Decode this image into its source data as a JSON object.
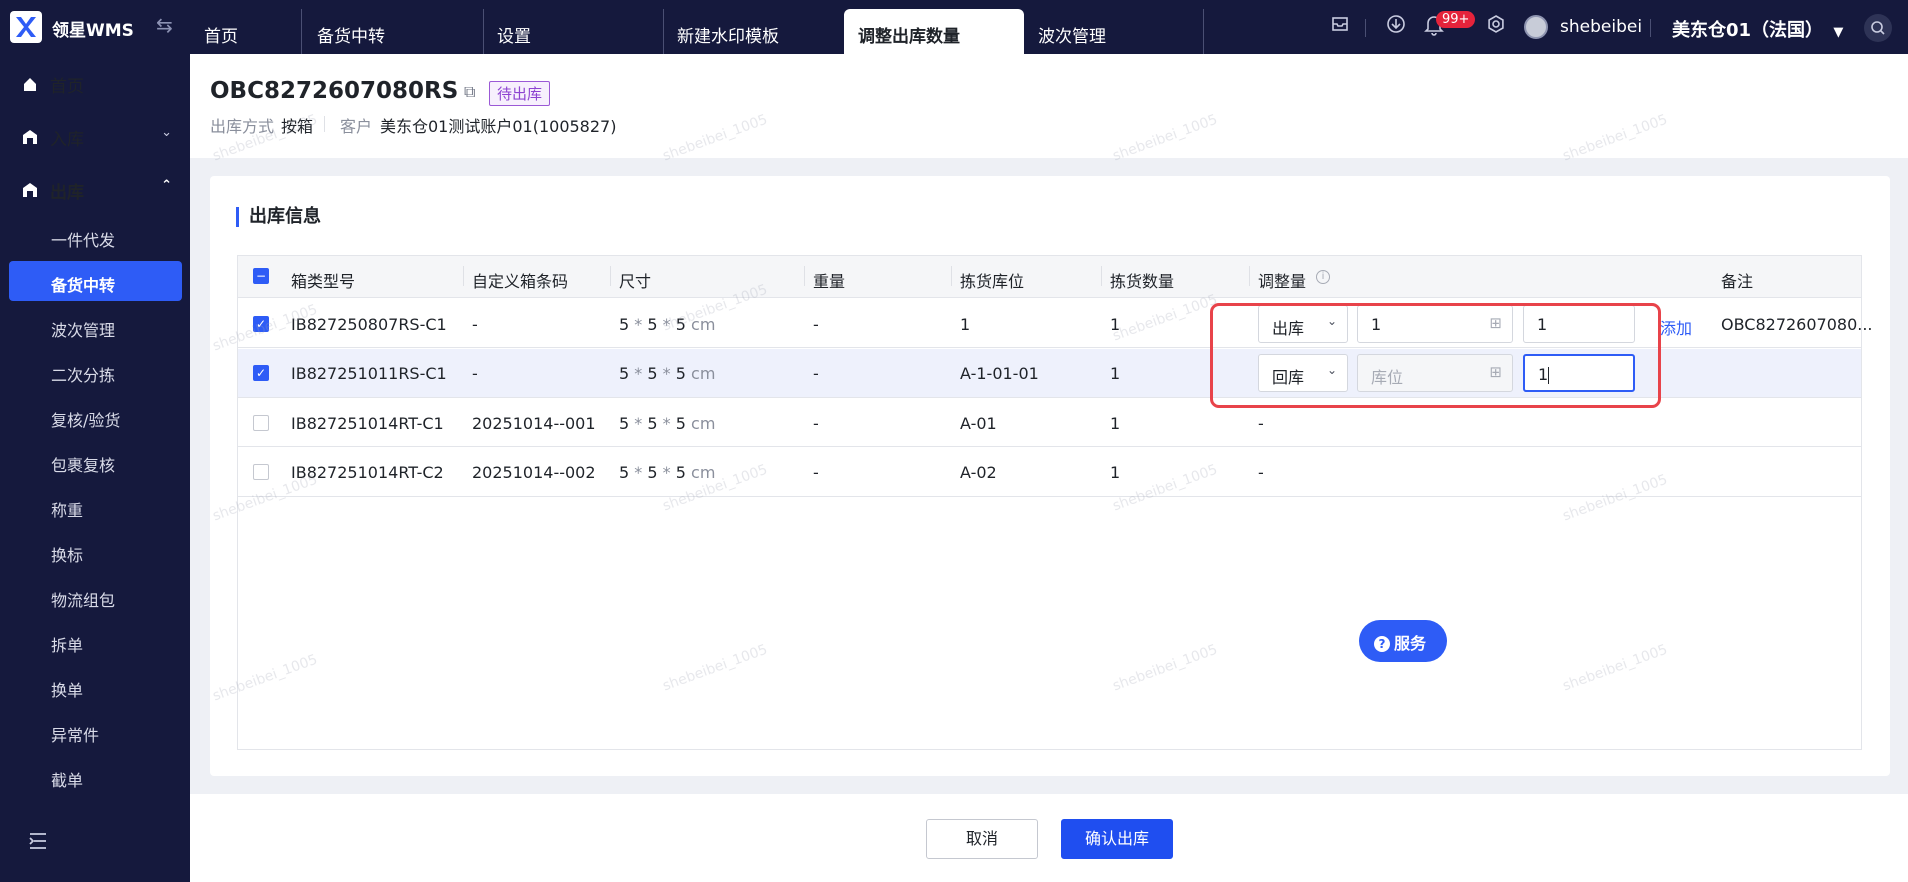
{
  "app": {
    "name": "领星WMS"
  },
  "tabs": [
    {
      "label": "首页"
    },
    {
      "label": "备货中转"
    },
    {
      "label": "设置"
    },
    {
      "label": "新建水印模板"
    },
    {
      "label": "调整出库数量"
    },
    {
      "label": "波次管理"
    }
  ],
  "topbar": {
    "notif_count": "99+",
    "username": "shebeibei",
    "warehouse": "美东仓01（法国）"
  },
  "sidebar": {
    "items": [
      {
        "label": "首页"
      },
      {
        "label": "入库"
      },
      {
        "label": "出库"
      }
    ],
    "sub": [
      {
        "label": "一件代发"
      },
      {
        "label": "备货中转"
      },
      {
        "label": "波次管理"
      },
      {
        "label": "二次分拣"
      },
      {
        "label": "复核/验货"
      },
      {
        "label": "包裹复核"
      },
      {
        "label": "称重"
      },
      {
        "label": "换标"
      },
      {
        "label": "物流组包"
      },
      {
        "label": "拆单"
      },
      {
        "label": "换单"
      },
      {
        "label": "异常件"
      },
      {
        "label": "截单"
      }
    ]
  },
  "order": {
    "id": "OBC8272607080RS",
    "status": "待出库",
    "method_label": "出库方式",
    "method": "按箱",
    "customer_label": "客户",
    "customer": "美东仓01测试账户01(1005827)"
  },
  "section": {
    "title": "出库信息"
  },
  "table": {
    "headers": [
      "箱类型号",
      "自定义箱条码",
      "尺寸",
      "重量",
      "拣货库位",
      "拣货数量",
      "调整量",
      "备注"
    ],
    "rows": [
      {
        "box": "IB827250807RS-C1",
        "barcode": "-",
        "d1": "5",
        "d2": "5",
        "d3": "5",
        "unit": "cm",
        "weight": "-",
        "location": "1",
        "qty": "1",
        "adj_type": "出库",
        "adj_loc": "1",
        "adj_qty": "1",
        "add": "添加",
        "remark": "OBC8272607080...",
        "checked": true
      },
      {
        "box": "IB827251011RS-C1",
        "barcode": "-",
        "d1": "5",
        "d2": "5",
        "d3": "5",
        "unit": "cm",
        "weight": "-",
        "location": "A-1-01-01",
        "qty": "1",
        "adj_type": "回库",
        "adj_loc_placeholder": "库位",
        "adj_qty": "1",
        "remark": "",
        "checked": true
      },
      {
        "box": "IB827251014RT-C1",
        "barcode": "20251014--001",
        "d1": "5",
        "d2": "5",
        "d3": "5",
        "unit": "cm",
        "weight": "-",
        "location": "A-01",
        "qty": "1",
        "adj": "-",
        "checked": false
      },
      {
        "box": "IB827251014RT-C2",
        "barcode": "20251014--002",
        "d1": "5",
        "d2": "5",
        "d3": "5",
        "unit": "cm",
        "weight": "-",
        "location": "A-02",
        "qty": "1",
        "adj": "-",
        "checked": false
      }
    ]
  },
  "service_label": "服务",
  "footer": {
    "cancel": "取消",
    "confirm": "确认出库"
  },
  "watermark": "shebeibei_1005",
  "colors": {
    "primary": "#2e5cf6",
    "nav_bg": "#15193d",
    "highlight_box": "#e8434a",
    "status_purple": "#8e44d1"
  }
}
